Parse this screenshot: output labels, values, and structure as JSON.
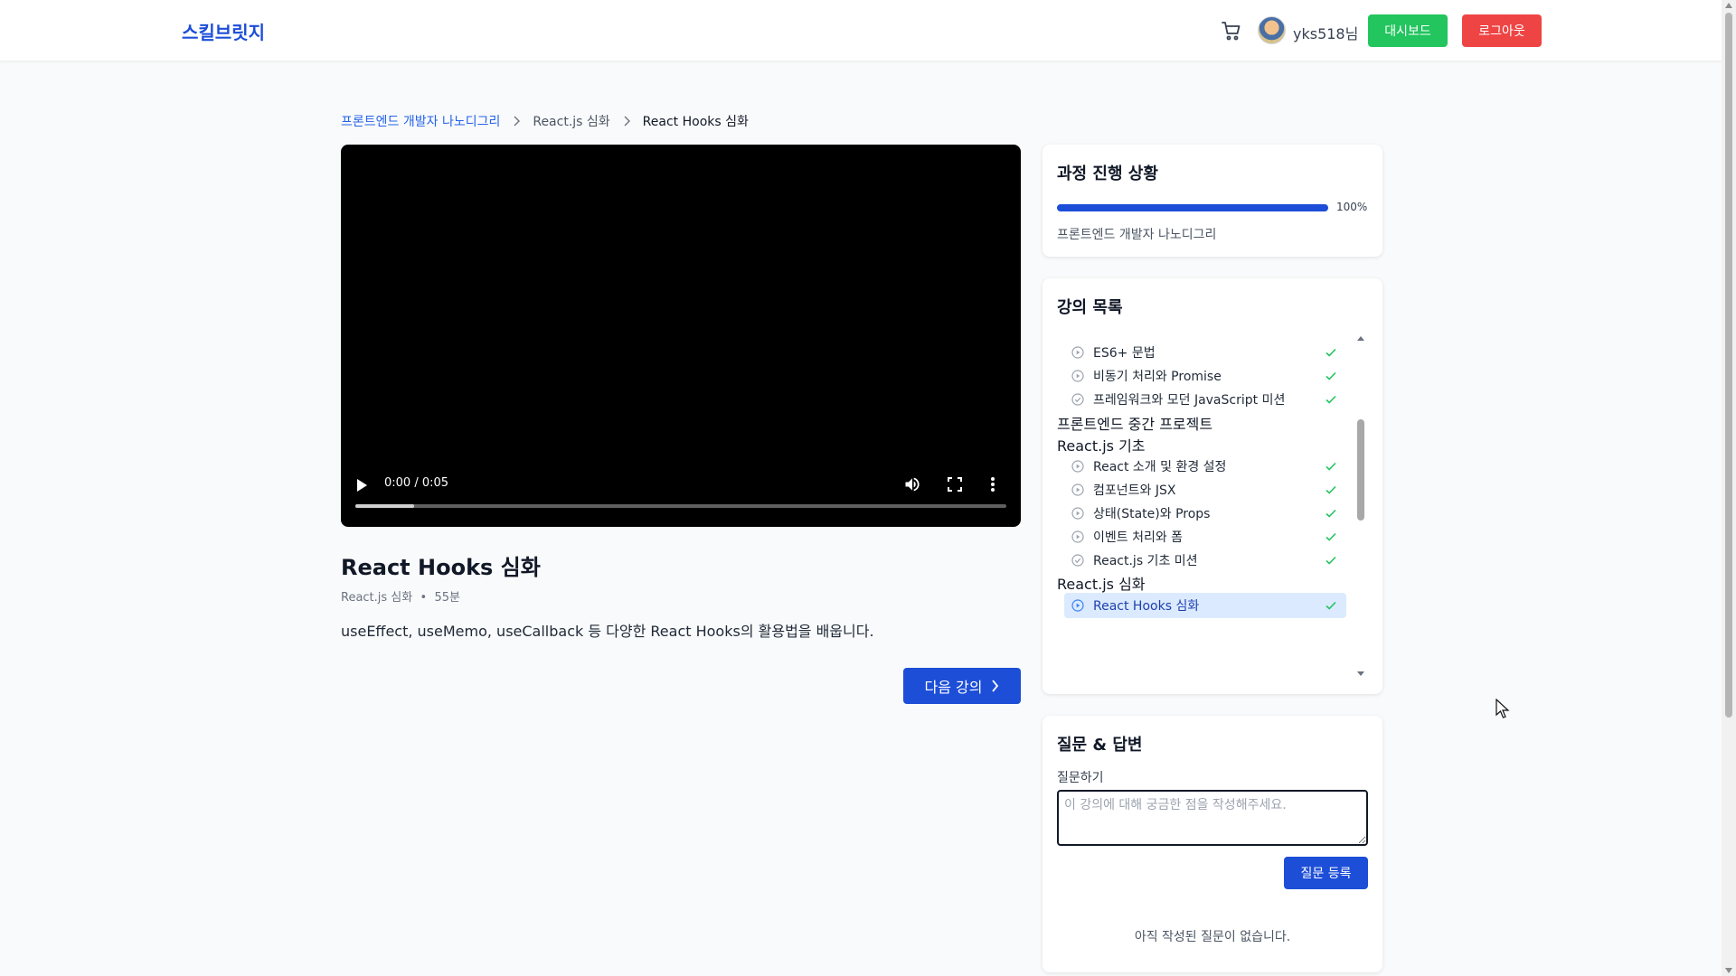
{
  "header": {
    "logo": "스킬브릿지",
    "cart_icon": "cart-icon",
    "username": "yks518님",
    "dashboard_label": "대시보드",
    "logout_label": "로그아웃",
    "colors": {
      "logo": "#1d4ed8",
      "dashboard": "#22c55e",
      "logout": "#ef4444"
    }
  },
  "breadcrumb": {
    "items": [
      "프론트엔드 개발자 나노디그리",
      "React.js 심화",
      "React Hooks 심화"
    ]
  },
  "video": {
    "time": "0:00 / 0:05",
    "buffered_fraction": 0.09,
    "icons": [
      "play-icon",
      "volume-icon",
      "fullscreen-icon",
      "more-icon"
    ]
  },
  "lesson": {
    "title": "React Hooks 심화",
    "section": "React.js 심화",
    "duration": "55분",
    "description": "useEffect, useMemo, useCallback 등 다양한 React Hooks의 활용법을 배웁니다.",
    "next_label": "다음 강의"
  },
  "progress": {
    "title": "과정 진행 상황",
    "percent_label": "100%",
    "fraction": 1.0,
    "course": "프론트엔드 개발자 나노디그리"
  },
  "lecture_list": {
    "title": "강의 목록",
    "rows": [
      {
        "kind": "item",
        "label": "ES6+ 문법",
        "icon": "play-circle-icon",
        "done": true
      },
      {
        "kind": "item",
        "label": "비동기 처리와 Promise",
        "icon": "play-circle-icon",
        "done": true
      },
      {
        "kind": "item",
        "label": "프레임워크와 모던 JavaScript 미션",
        "icon": "check-circle-icon",
        "done": true
      },
      {
        "kind": "section",
        "label": "프론트엔드 중간 프로젝트"
      },
      {
        "kind": "section",
        "label": "React.js 기초"
      },
      {
        "kind": "item",
        "label": "React 소개 및 환경 설정",
        "icon": "play-circle-icon",
        "done": true
      },
      {
        "kind": "item",
        "label": "컴포넌트와 JSX",
        "icon": "play-circle-icon",
        "done": true
      },
      {
        "kind": "item",
        "label": "상태(State)와 Props",
        "icon": "play-circle-icon",
        "done": true
      },
      {
        "kind": "item",
        "label": "이벤트 처리와 폼",
        "icon": "play-circle-icon",
        "done": true
      },
      {
        "kind": "item",
        "label": "React.js 기초 미션",
        "icon": "check-circle-icon",
        "done": true
      },
      {
        "kind": "section",
        "label": "React.js 심화"
      },
      {
        "kind": "item",
        "label": "React Hooks 심화",
        "icon": "play-circle-icon",
        "done": true,
        "active": true
      }
    ]
  },
  "qa": {
    "title": "질문 & 답변",
    "ask_label": "질문하기",
    "placeholder": "이 강의에 대해 궁금한 점을 작성해주세요.",
    "value": "",
    "submit_label": "질문 등록",
    "empty_text": "아직 작성된 질문이 없습니다."
  }
}
